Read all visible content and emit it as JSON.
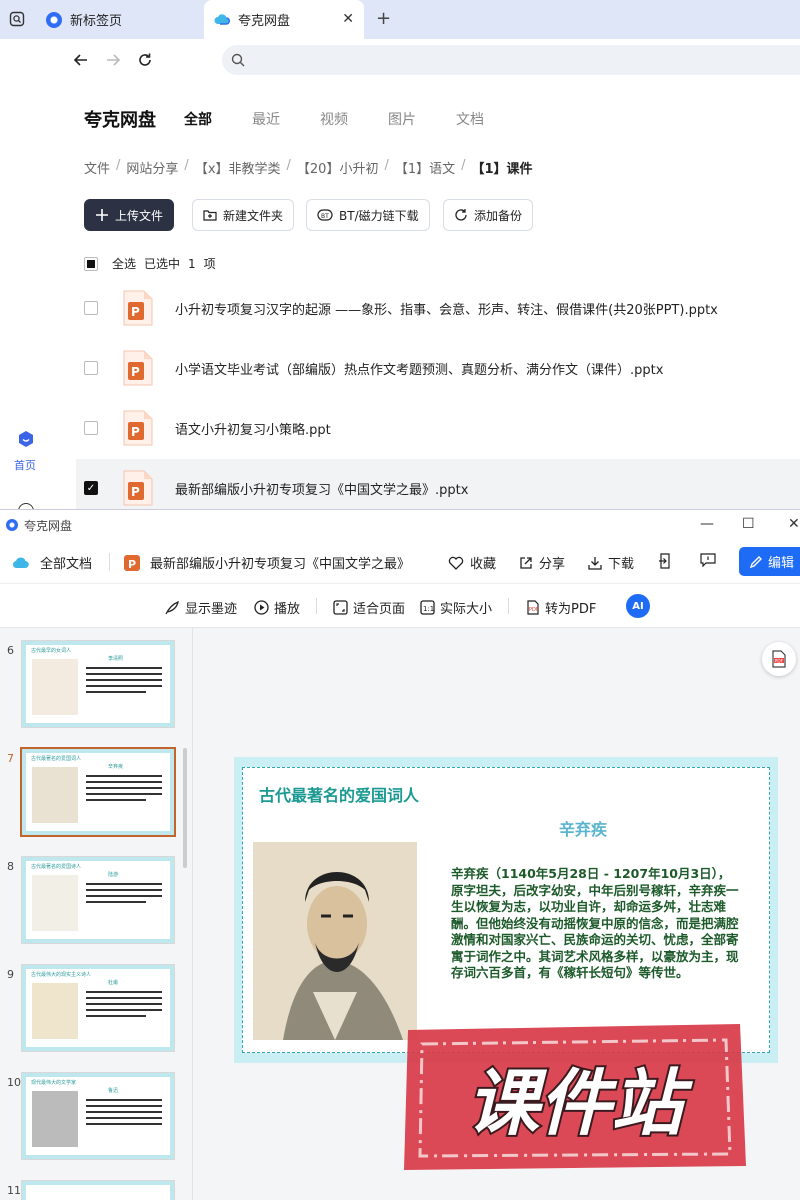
{
  "browser": {
    "tabs": [
      {
        "label": "新标签页"
      },
      {
        "label": "夸克网盘"
      }
    ]
  },
  "rail": {
    "home_label": "首页"
  },
  "drive": {
    "title": "夸克网盘",
    "tabs": [
      "全部",
      "最近",
      "视频",
      "图片",
      "文档"
    ],
    "breadcrumb": [
      "文件",
      "网站分享",
      "【x】非教学类",
      "【20】小升初",
      "【1】语文",
      "【1】课件"
    ],
    "actions": {
      "upload": "上传文件",
      "new_folder": "新建文件夹",
      "bt": "BT/磁力链下载",
      "backup": "添加备份"
    },
    "select_all": "全选",
    "selected_text": "已选中",
    "selected_count": "1",
    "selected_unit": "项",
    "files": [
      {
        "name": "小升初专项复习汉字的起源 ——象形、指事、会意、形声、转注、假借课件(共20张PPT).pptx",
        "checked": false
      },
      {
        "name": "小学语文毕业考试（部编版）热点作文考题预测、真题分析、满分作文（课件）.pptx",
        "checked": false
      },
      {
        "name": "语文小升初复习小策略.ppt",
        "checked": false
      },
      {
        "name": "最新部编版小升初专项复习《中国文学之最》.pptx",
        "checked": true
      }
    ]
  },
  "viewer": {
    "window_title": "夸克网盘",
    "toolbar1": {
      "all_docs": "全部文档",
      "doc_name": "最新部编版小升初专项复习《中国文学之最》",
      "favorite": "收藏",
      "share": "分享",
      "download": "下载",
      "edit": "编辑"
    },
    "toolbar2": {
      "ink": "显示墨迹",
      "play": "播放",
      "fit": "适合页面",
      "actual": "实际大小",
      "to_pdf": "转为PDF",
      "ai": "AI"
    },
    "thumbnails": [
      {
        "num": "6",
        "heading": "古代最早的女词人",
        "name": "李清照"
      },
      {
        "num": "7",
        "heading": "古代最著名的爱国词人",
        "name": "辛弃疾"
      },
      {
        "num": "8",
        "heading": "古代最著名的爱国诗人",
        "name": "陆游"
      },
      {
        "num": "9",
        "heading": "古代最伟大的现实主义诗人",
        "name": "杜甫"
      },
      {
        "num": "10",
        "heading": "现代最伟大的文学家",
        "name": "鲁迅"
      },
      {
        "num": "11",
        "heading": "",
        "name": ""
      }
    ],
    "slide": {
      "title": "古代最著名的爱国词人",
      "name": "辛弃疾",
      "body": "辛弃疾（1140年5月28日 - 1207年10月3日），原字坦夫，后改字幼安，中年后别号稼轩，辛弃疾一生以恢复为志，以功业自许，却命运多舛，壮志难酬。但他始终没有动摇恢复中原的信念，而是把满腔激情和对国家兴亡、民族命运的关切、忧虑，全部寄寓于词作之中。其词艺术风格多样，以豪放为主，现存词六百多首，有《稼轩长短句》等传世。"
    },
    "watermark": "课件站"
  },
  "colors": {
    "accent": "#1e6bf5",
    "upload_btn": "#2c3243",
    "ppt_icon": "#e0692f",
    "slide_title": "#1b9a93",
    "slide_body": "#1d5a2a",
    "stamp_red": "#d83a48"
  }
}
